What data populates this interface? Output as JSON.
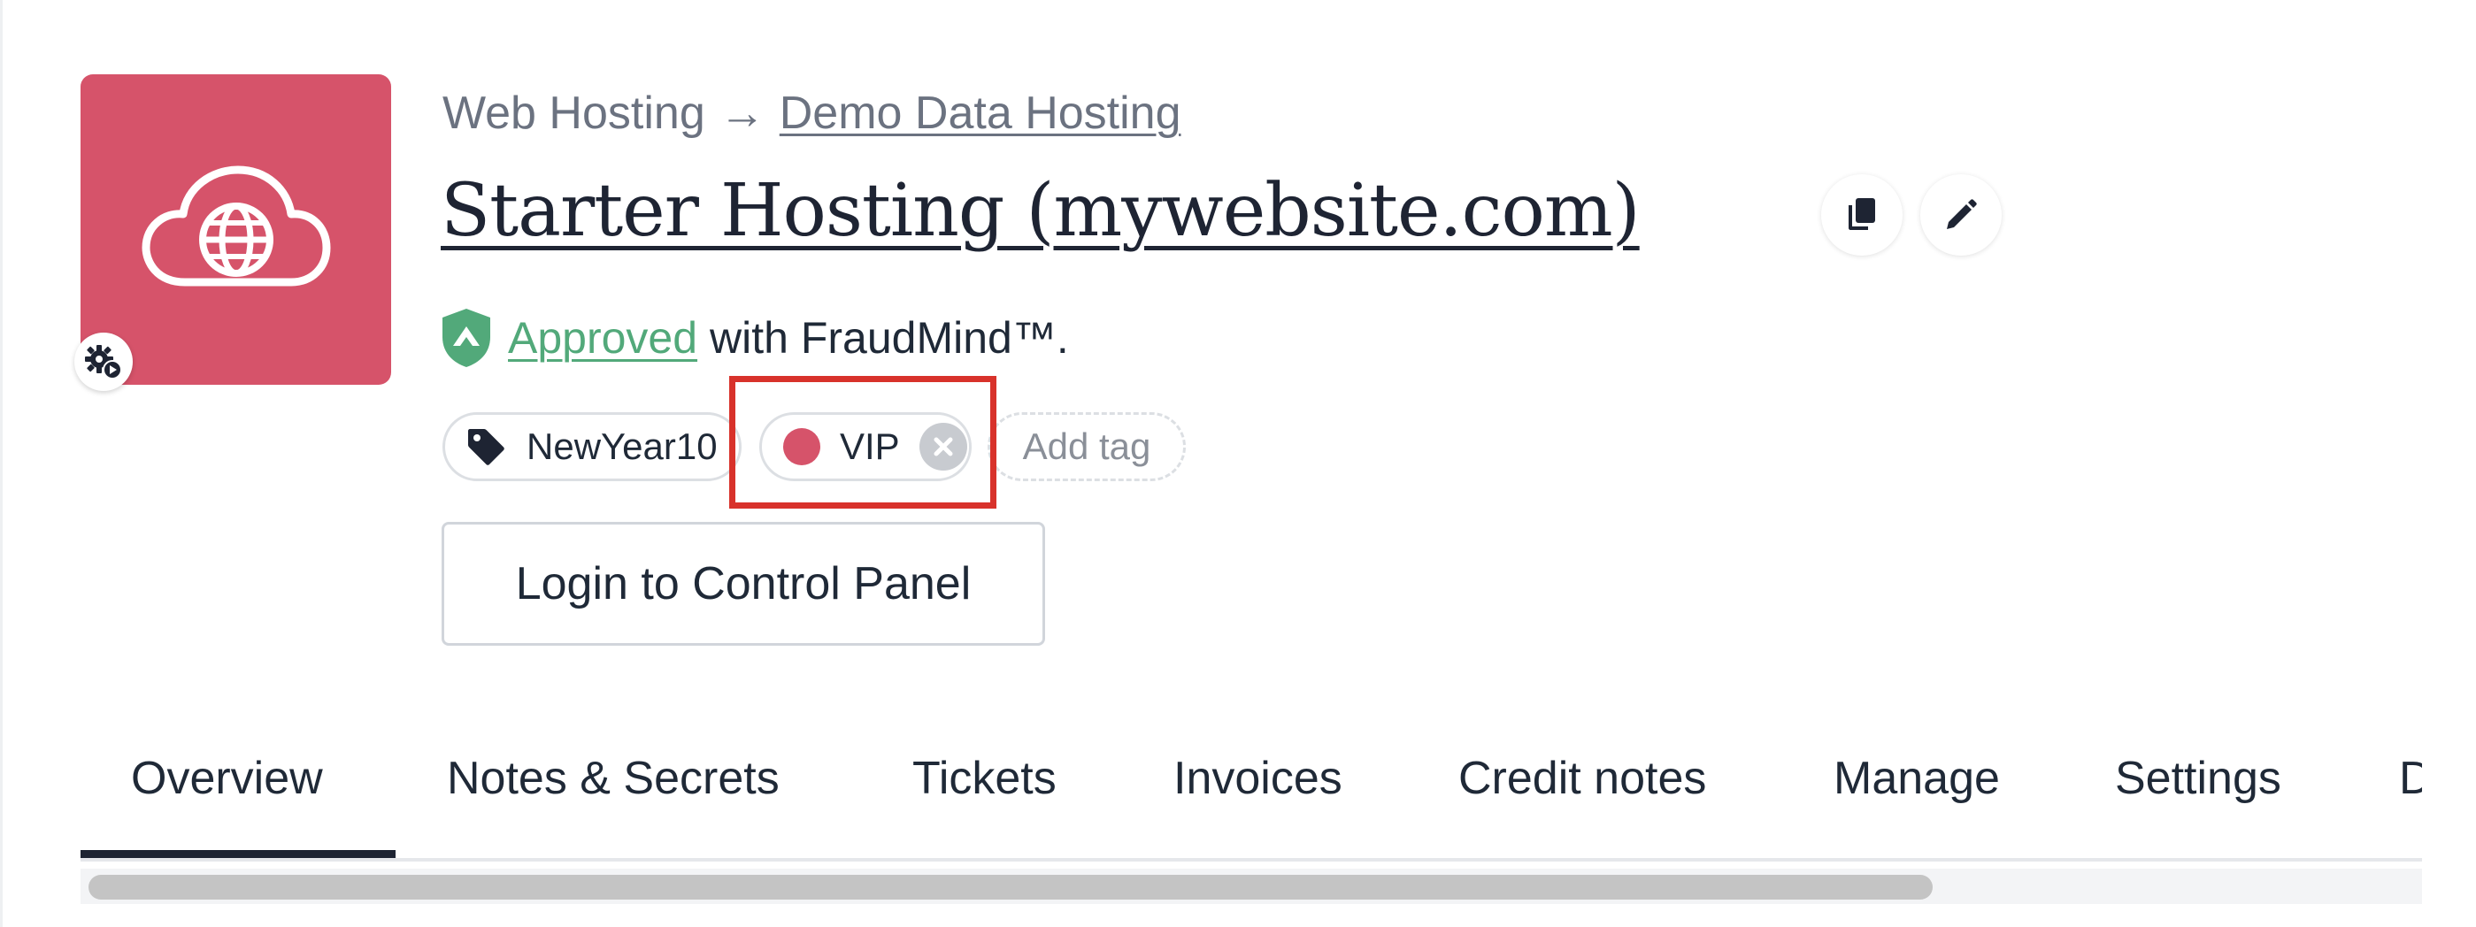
{
  "breadcrumb": {
    "parent": "Web Hosting",
    "separator": "→",
    "current": "Demo Data Hosting"
  },
  "header": {
    "title": "Starter Hosting (mywebsite.com)",
    "actions": [
      {
        "icon": "copy-icon"
      },
      {
        "icon": "pencil-icon"
      }
    ]
  },
  "product_icon": {
    "icon": "cloud-globe-icon",
    "background": "#d6536a",
    "badge_icon": "gear-play-icon"
  },
  "fraud": {
    "status": "Approved",
    "suffix": "with FraudMind™.",
    "status_color": "#52a97a",
    "icon": "shield-icon"
  },
  "tags": {
    "items": [
      {
        "label": "NewYear10",
        "icon": "tag-icon"
      },
      {
        "label": "VIP",
        "dot_color": "#d6536a",
        "icon": "remove-x-icon"
      }
    ],
    "add_label": "Add tag",
    "highlight_color": "#d8322b"
  },
  "login_button": "Login to Control Panel",
  "tabs": [
    {
      "label": "Overview",
      "active": true
    },
    {
      "label": "Notes & Secrets"
    },
    {
      "label": "Tickets"
    },
    {
      "label": "Invoices"
    },
    {
      "label": "Credit notes"
    },
    {
      "label": "Manage"
    },
    {
      "label": "Settings"
    },
    {
      "label": "D"
    }
  ]
}
